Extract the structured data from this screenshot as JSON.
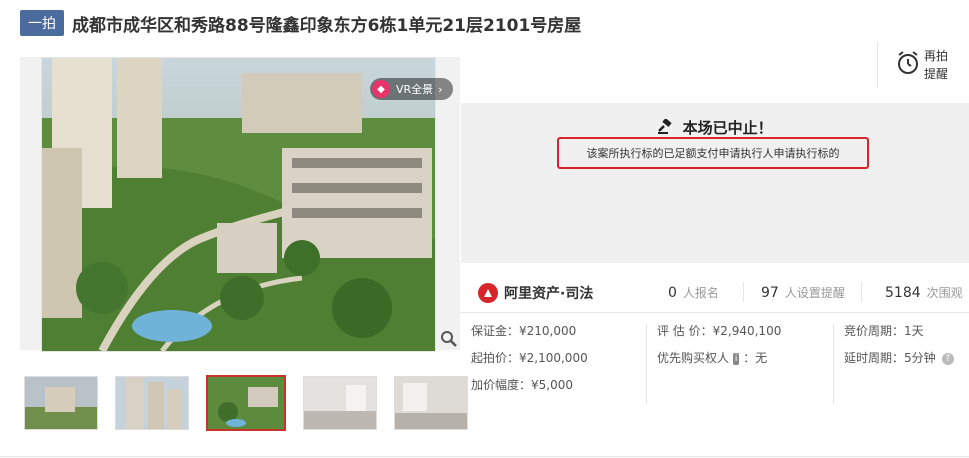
{
  "header": {
    "badge": "一拍",
    "title": "成都市成华区和秀路88号隆鑫印象东方6栋1单元21层2101号房屋"
  },
  "gallery": {
    "vr_label": "VR全景",
    "thumbnails_count": 5,
    "active_thumbnail": 3
  },
  "reminder": {
    "line1": "再拍",
    "line2": "提醒"
  },
  "status": {
    "title": "本场已中止！",
    "reason": "该案所执行标的已足额支付申请执行人申请执行标的"
  },
  "brand": {
    "name": "阿里资产·司法"
  },
  "stats": {
    "signups_num": "0",
    "signups_label": "人报名",
    "reminders_num": "97",
    "reminders_label": "人设置提醒",
    "views_num": "5184",
    "views_label": "次围观"
  },
  "details": {
    "deposit": "保证金：¥210,000",
    "start_price": "起拍价：¥2,100,000",
    "increment": "加价幅度：¥5,000",
    "appraisal": "评 估 价：¥2,940,100",
    "priority_label": "优先购买权人",
    "priority_tag": "i",
    "priority_value": "：无",
    "cycle": "竞价周期：1天",
    "delay": "延时周期：5分钟"
  },
  "colors": {
    "accent_red": "#d6262c",
    "badge_blue": "#4b6b9e",
    "panel_gray": "#f0f0f0"
  }
}
